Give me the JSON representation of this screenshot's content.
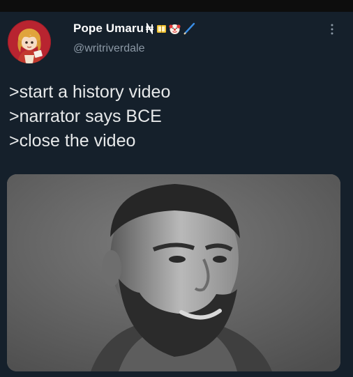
{
  "tweet": {
    "display_name": "Pope Umaru",
    "handle": "@writriverdale",
    "lines": [
      ">start a history video",
      ">narrator says BCE",
      ">close the video"
    ]
  },
  "icons": {
    "avatar": "anime-character-avatar",
    "name_emoji": [
      "naira-currency-symbol",
      "ledger-book-emoji",
      "clown-face-emoji",
      "pencil-emoji"
    ],
    "more": "more-vertical-icon"
  },
  "colors": {
    "background": "#15202b",
    "text": "#e7e9ea",
    "secondary_text": "#8b98a5"
  }
}
